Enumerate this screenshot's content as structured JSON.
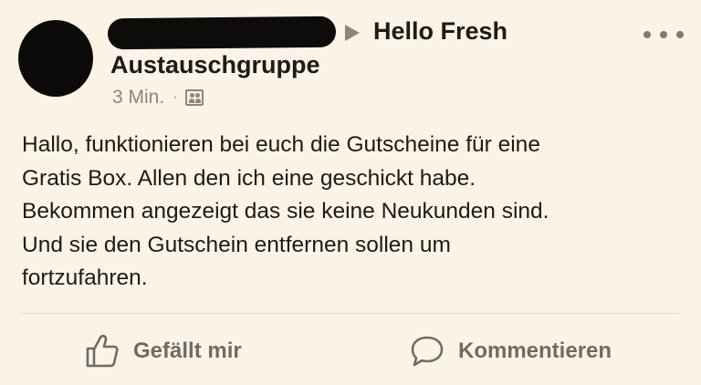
{
  "post": {
    "group_prefix": "Hello Fresh",
    "group_suffix": "Austauschgruppe",
    "timestamp": "3 Min.",
    "separator": "·",
    "audience_icon": "group-icon",
    "body_lines": [
      "Hallo, funktionieren bei euch die Gutscheine für eine",
      "Gratis Box. Allen den ich eine geschickt habe.",
      "Bekommen angezeigt das sie keine Neukunden sind.",
      "Und sie den Gutschein entfernen sollen um",
      "fortzufahren."
    ]
  },
  "actions": {
    "like_label": "Gefällt mir",
    "comment_label": "Kommentieren"
  },
  "colors": {
    "background": "#fbf3e6",
    "text": "#1d1b18",
    "muted": "#8a8680",
    "redaction": "#0e0c0a"
  }
}
